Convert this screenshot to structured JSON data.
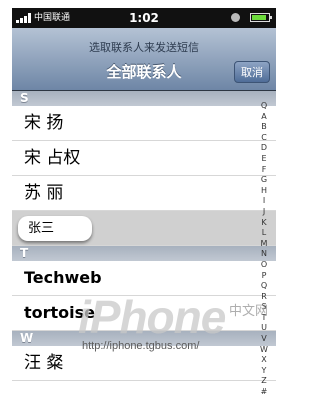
{
  "status": {
    "carrier": "中国联通",
    "time": "1:02"
  },
  "nav": {
    "prompt": "选取联系人来发送短信",
    "title": "全部联系人",
    "cancel": "取消"
  },
  "sections": [
    {
      "letter": "S",
      "rows": [
        "宋  扬",
        "宋  占权",
        "苏  丽"
      ],
      "selected": "张三"
    },
    {
      "letter": "T",
      "rows": [
        "Techweb",
        "tortoise"
      ]
    },
    {
      "letter": "W",
      "rows": [
        "汪  粲"
      ]
    }
  ],
  "index": [
    "Q",
    "A",
    "B",
    "C",
    "D",
    "E",
    "F",
    "G",
    "H",
    "I",
    "J",
    "K",
    "L",
    "M",
    "N",
    "O",
    "P",
    "Q",
    "R",
    "S",
    "T",
    "U",
    "V",
    "W",
    "X",
    "Y",
    "Z",
    "#"
  ],
  "watermark": {
    "logo": "iPhone",
    "cn": "中文网",
    "url": "http://iphone.tgbus.com/"
  },
  "colors": {
    "battery": "#6ddc3c",
    "navbar": "#6e86a6"
  }
}
